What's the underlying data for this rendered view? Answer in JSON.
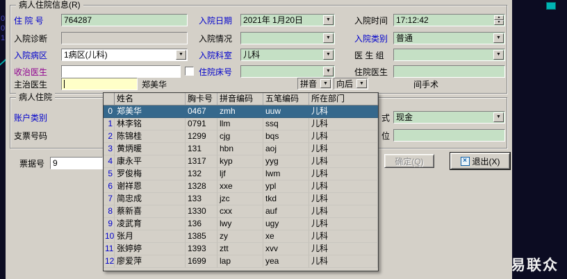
{
  "window": {
    "brand": "易联众",
    "edge_digits": "001"
  },
  "group_patient": {
    "title": "病人住院信息(R)",
    "admission_no_label": "住 院 号",
    "admission_no_value": "764287",
    "admission_date_label": "入院日期",
    "admission_date_value": "2021年 1月20日",
    "admission_time_label": "入院时间",
    "admission_time_value": "17:12:42",
    "diagnosis_label": "入院诊断",
    "diagnosis_value": "",
    "condition_label": "入院情况",
    "condition_value": "",
    "category_label": "入院类别",
    "category_value": "普通",
    "ward_label": "入院病区",
    "ward_value": "1病区(儿科)",
    "dept_label": "入院科室",
    "dept_value": "儿科",
    "doctor_group_label": "医 生 组",
    "doctor_group_value": "",
    "admit_doctor_label": "收治医生",
    "admit_doctor_value": "",
    "bed_label": "住院床号",
    "bed_value": "",
    "resident_label": "住院医生",
    "resident_value": "",
    "attending_label": "主治医生",
    "attending_input_value": "",
    "attending_selected_name": "郑美华",
    "search_mode_label": "拼音",
    "direction_label": "向后",
    "surgery_text": "间手术"
  },
  "group_account": {
    "title": "病人住院",
    "account_type_label": "账户类别",
    "check_no_label": "支票号码",
    "pay_mode_fragment": "式",
    "pay_mode_value": "现金",
    "unit_fragment": "位",
    "receipt_label": "票据号",
    "receipt_value": "9"
  },
  "buttons": {
    "confirm": "确定(Q)",
    "exit": "退出(X)"
  },
  "doctor_table": {
    "columns": [
      "姓名",
      "胸卡号",
      "拼音编码",
      "五笔编码",
      "所在部门"
    ],
    "selected_index": 0,
    "rows": [
      [
        "郑美华",
        "0467",
        "zmh",
        "uuw",
        "儿科"
      ],
      [
        "林李铭",
        "0791",
        "llm",
        "ssq",
        "儿科"
      ],
      [
        "陈锦桂",
        "1299",
        "cjg",
        "bqs",
        "儿科"
      ],
      [
        "黄炳暖",
        "131",
        "hbn",
        "aoj",
        "儿科"
      ],
      [
        "康永平",
        "1317",
        "kyp",
        "yyg",
        "儿科"
      ],
      [
        "罗俊梅",
        "132",
        "ljf",
        "lwm",
        "儿科"
      ],
      [
        "谢祥恩",
        "1328",
        "xxe",
        "ypl",
        "儿科"
      ],
      [
        "简忠成",
        "133",
        "jzc",
        "tkd",
        "儿科"
      ],
      [
        "蔡新喜",
        "1330",
        "cxx",
        "auf",
        "儿科"
      ],
      [
        "凌武育",
        "136",
        "lwy",
        "ugy",
        "儿科"
      ],
      [
        "张月",
        "1385",
        "zy",
        "xe",
        "儿科"
      ],
      [
        "张婷婷",
        "1393",
        "ztt",
        "xvv",
        "儿科"
      ],
      [
        "廖爱萍",
        "1699",
        "lap",
        "yea",
        "儿科"
      ]
    ]
  },
  "colors": {
    "field_green": "#c5e0c5",
    "field_yellow": "#ffffc8",
    "selected_row": "#35688c",
    "label_blue": "#0000cc",
    "label_purple": "#900090",
    "desktop_bg": "#0c0c22"
  }
}
